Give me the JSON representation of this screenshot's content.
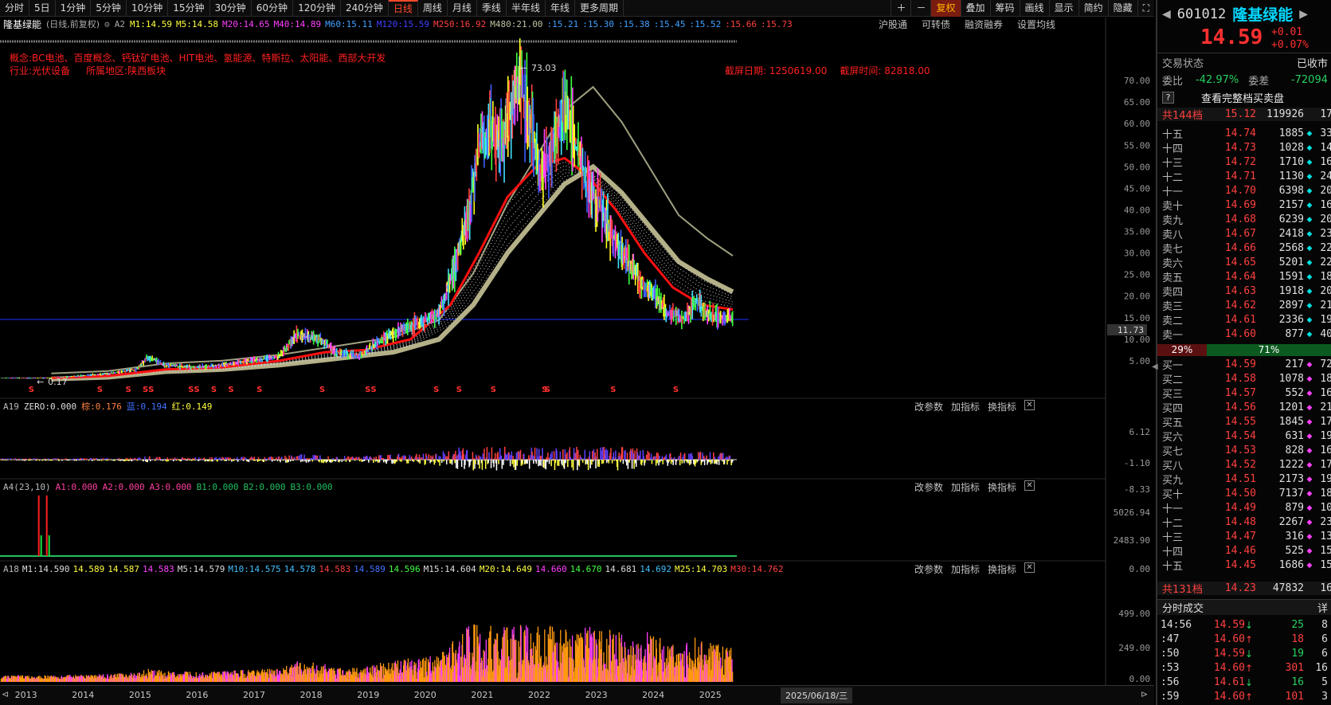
{
  "toolbar": {
    "periods": [
      "分时",
      "5日",
      "1分钟",
      "5分钟",
      "10分钟",
      "15分钟",
      "30分钟",
      "60分钟",
      "120分钟",
      "240分钟",
      "日线",
      "周线",
      "月线",
      "季线",
      "半年线",
      "年线",
      "更多周期"
    ],
    "right": [
      "复权",
      "叠加",
      "筹码",
      "画线",
      "显示",
      "简约",
      "隐藏"
    ]
  },
  "header": {
    "name": "隆基绿能",
    "period": "(日线,前复权)",
    "a2": "A2",
    "ma": [
      {
        "t": "M1:14.59",
        "c": "#ffff40"
      },
      {
        "t": "M5:14.58",
        "c": "#ffff40"
      },
      {
        "t": "M20:14.65",
        "c": "#ff40ff"
      },
      {
        "t": "M40:14.89",
        "c": "#ff40ff"
      },
      {
        "t": "M60:15.11",
        "c": "#40a0ff"
      },
      {
        "t": "M120:15.59",
        "c": "#4040ff"
      },
      {
        "t": "M250:16.92",
        "c": "#ff4040"
      },
      {
        "t": "M480:21.00",
        "c": "#c0c0a0"
      },
      {
        "t": ":15.21",
        "c": "#40a0ff"
      },
      {
        "t": ":15.30",
        "c": "#40a0ff"
      },
      {
        "t": ":15.38",
        "c": "#40a0ff"
      },
      {
        "t": ":15.45",
        "c": "#40a0ff"
      },
      {
        "t": ":15.52",
        "c": "#40a0ff"
      },
      {
        "t": ":15.66",
        "c": "#ff4040"
      },
      {
        "t": ":15.73",
        "c": "#ff4040"
      }
    ],
    "links": [
      "沪股通",
      "可转债",
      "融资融券",
      "设置均线"
    ]
  },
  "info": {
    "concepts": "概念:BC电池、百度概念、钙钛矿电池、HIT电池、氢能源、特斯拉、太阳能、西部大开发",
    "industry": "行业:光伏设备",
    "region": "所属地区:陕西板块",
    "shot_date": "截屏日期: 1250619.00",
    "shot_time": "截屏时间: 82818.00"
  },
  "chart_data": {
    "type": "line",
    "title": "隆基绿能",
    "x_years": [
      "2013",
      "2014",
      "2015",
      "2016",
      "2017",
      "2018",
      "2019",
      "2020",
      "2021",
      "2022",
      "2023",
      "2024",
      "2025"
    ],
    "y_ticks": [
      "70.00",
      "65.00",
      "60.00",
      "55.00",
      "50.00",
      "45.00",
      "40.00",
      "35.00",
      "30.00",
      "25.00",
      "20.00",
      "15.00",
      "10.00",
      "5.00"
    ],
    "ylim": [
      0,
      75
    ],
    "high_label": "73.03",
    "low_label": "0.17",
    "current_price_tag": "11.73",
    "close_points": [
      [
        2013.0,
        1.0
      ],
      [
        2013.5,
        1.0
      ],
      [
        2014.0,
        1.5
      ],
      [
        2014.5,
        2.0
      ],
      [
        2015.0,
        3.0
      ],
      [
        2015.2,
        6.0
      ],
      [
        2015.5,
        4.0
      ],
      [
        2016.0,
        3.5
      ],
      [
        2016.5,
        4.0
      ],
      [
        2017.0,
        5.0
      ],
      [
        2017.5,
        6.0
      ],
      [
        2017.8,
        11.0
      ],
      [
        2018.2,
        10.0
      ],
      [
        2018.5,
        7.0
      ],
      [
        2018.9,
        6.0
      ],
      [
        2019.3,
        10.0
      ],
      [
        2019.6,
        12.0
      ],
      [
        2020.0,
        14.0
      ],
      [
        2020.3,
        16.0
      ],
      [
        2020.6,
        28.0
      ],
      [
        2020.8,
        38.0
      ],
      [
        2021.0,
        55.0
      ],
      [
        2021.2,
        58.0
      ],
      [
        2021.4,
        55.0
      ],
      [
        2021.7,
        70.0
      ],
      [
        2021.9,
        60.0
      ],
      [
        2022.1,
        48.0
      ],
      [
        2022.3,
        55.0
      ],
      [
        2022.5,
        65.0
      ],
      [
        2022.7,
        55.0
      ],
      [
        2022.9,
        45.0
      ],
      [
        2023.1,
        42.0
      ],
      [
        2023.3,
        35.0
      ],
      [
        2023.6,
        28.0
      ],
      [
        2023.9,
        22.0
      ],
      [
        2024.1,
        20.0
      ],
      [
        2024.3,
        16.0
      ],
      [
        2024.6,
        15.0
      ],
      [
        2024.8,
        19.0
      ],
      [
        2025.0,
        16.0
      ],
      [
        2025.3,
        15.0
      ],
      [
        2025.45,
        14.6
      ]
    ],
    "ma250_points": [
      [
        2013.5,
        1.0
      ],
      [
        2014.5,
        1.5
      ],
      [
        2015.5,
        3.0
      ],
      [
        2016.5,
        3.5
      ],
      [
        2017.5,
        5.0
      ],
      [
        2018.3,
        7.0
      ],
      [
        2019.0,
        7.5
      ],
      [
        2019.8,
        10.0
      ],
      [
        2020.5,
        18.0
      ],
      [
        2021.0,
        30.0
      ],
      [
        2021.5,
        43.0
      ],
      [
        2022.0,
        50.0
      ],
      [
        2022.5,
        52.0
      ],
      [
        2022.9,
        48.0
      ],
      [
        2023.4,
        40.0
      ],
      [
        2023.9,
        30.0
      ],
      [
        2024.4,
        22.0
      ],
      [
        2024.9,
        18.0
      ],
      [
        2025.45,
        16.9
      ]
    ],
    "ma480_points": [
      [
        2013.5,
        0.8
      ],
      [
        2014.5,
        1.2
      ],
      [
        2015.5,
        2.5
      ],
      [
        2016.5,
        3.0
      ],
      [
        2017.5,
        4.0
      ],
      [
        2018.5,
        5.5
      ],
      [
        2019.5,
        7.0
      ],
      [
        2020.3,
        10.0
      ],
      [
        2020.9,
        18.0
      ],
      [
        2021.5,
        30.0
      ],
      [
        2022.0,
        38.0
      ],
      [
        2022.5,
        46.0
      ],
      [
        2023.0,
        50.0
      ],
      [
        2023.5,
        44.0
      ],
      [
        2024.0,
        36.0
      ],
      [
        2024.5,
        28.0
      ],
      [
        2025.0,
        24.0
      ],
      [
        2025.45,
        21.0
      ]
    ],
    "markers_s": [
      2013.1,
      2014.3,
      2014.8,
      2015.1,
      2015.2,
      2015.9,
      2016.0,
      2016.3,
      2016.6,
      2017.1,
      2018.2,
      2019.0,
      2019.1,
      2020.2,
      2020.6,
      2021.2,
      2022.1,
      2022.15,
      2023.3,
      2024.4
    ]
  },
  "sub1": {
    "label": "A19",
    "params": [
      "ZERO:0.000",
      "棕:0.176",
      "蓝:0.194",
      "红:0.149"
    ],
    "ticks": [
      "6.12",
      "-1.10",
      "-8.33"
    ]
  },
  "sub2": {
    "label": "A4(23,10)",
    "params": [
      "A1:0.000",
      "A2:0.000",
      "A3:0.000",
      "B1:0.000",
      "B2:0.000",
      "B3:0.000"
    ],
    "ticks": [
      "5026.94",
      "2483.90",
      "0.00"
    ]
  },
  "sub3": {
    "label": "A18",
    "params": [
      "M1:14.590",
      "14.589",
      "14.587",
      "14.583",
      "M5:14.579",
      "M10:14.575",
      "14.578",
      "14.583",
      "14.589",
      "14.596",
      "M15:14.604",
      "M20:14.649",
      "14.660",
      "14.670",
      "14.681",
      "14.692",
      "M25:14.703",
      "M30:14.762"
    ],
    "ticks": [
      "499.00",
      "249.00",
      "0.00"
    ]
  },
  "pane_tools": [
    "改参数",
    "加指标",
    "换指标"
  ],
  "bottom_date": "2025/06/18/三",
  "right_panel": {
    "code": "601012",
    "name": "隆基绿能",
    "price": "14.59",
    "chg": "+0.01",
    "pct": "+0.07%",
    "status_label": "交易状态",
    "status": "已收市",
    "webi_label": "委比",
    "webi": "-42.97%",
    "weicha_label": "委差",
    "weicha": "-72094",
    "full_book": "查看完整档买卖盘",
    "sell_total": {
      "label": "共144档",
      "price": "15.12",
      "vol": "119926",
      "n": "17"
    },
    "asks": [
      [
        "十五",
        "14.74",
        "1885",
        "33"
      ],
      [
        "十四",
        "14.73",
        "1028",
        "14"
      ],
      [
        "十三",
        "14.72",
        "1710",
        "16"
      ],
      [
        "十二",
        "14.71",
        "1130",
        "24"
      ],
      [
        "十一",
        "14.70",
        "6398",
        "20"
      ],
      [
        "卖十",
        "14.69",
        "2157",
        "16"
      ],
      [
        "卖九",
        "14.68",
        "6239",
        "20"
      ],
      [
        "卖八",
        "14.67",
        "2418",
        "23"
      ],
      [
        "卖七",
        "14.66",
        "2568",
        "22"
      ],
      [
        "卖六",
        "14.65",
        "5201",
        "22"
      ],
      [
        "卖五",
        "14.64",
        "1591",
        "18"
      ],
      [
        "卖四",
        "14.63",
        "1918",
        "20"
      ],
      [
        "卖三",
        "14.62",
        "2897",
        "21"
      ],
      [
        "卖二",
        "14.61",
        "2336",
        "19"
      ],
      [
        "卖一",
        "14.60",
        "877",
        "40"
      ]
    ],
    "ratio_sell": "29%",
    "ratio_buy": "71%",
    "bids": [
      [
        "买一",
        "14.59",
        "217",
        "72"
      ],
      [
        "买二",
        "14.58",
        "1078",
        "18"
      ],
      [
        "买三",
        "14.57",
        "552",
        "16"
      ],
      [
        "买四",
        "14.56",
        "1201",
        "21"
      ],
      [
        "买五",
        "14.55",
        "1845",
        "17"
      ],
      [
        "买六",
        "14.54",
        "631",
        "19"
      ],
      [
        "买七",
        "14.53",
        "828",
        "16"
      ],
      [
        "买八",
        "14.52",
        "1222",
        "17"
      ],
      [
        "买九",
        "14.51",
        "2173",
        "19"
      ],
      [
        "买十",
        "14.50",
        "7137",
        "18"
      ],
      [
        "十一",
        "14.49",
        "879",
        "10"
      ],
      [
        "十二",
        "14.48",
        "2267",
        "23"
      ],
      [
        "十三",
        "14.47",
        "316",
        "13"
      ],
      [
        "十四",
        "14.46",
        "525",
        "15"
      ],
      [
        "十五",
        "14.45",
        "1686",
        "15"
      ]
    ],
    "buy_total": {
      "label": "共131档",
      "price": "14.23",
      "vol": "47832",
      "n": "16"
    },
    "ticks_title": "分时成交",
    "ticks_more": "详",
    "trades": [
      [
        "14:56",
        "14.59",
        "25",
        "8"
      ],
      [
        ":47",
        "14.60",
        "18",
        "6"
      ],
      [
        ":50",
        "14.59",
        "19",
        "6"
      ],
      [
        ":53",
        "14.60",
        "301",
        "16"
      ],
      [
        ":56",
        "14.61",
        "16",
        "5"
      ],
      [
        ":59",
        "14.60",
        "101",
        "3"
      ]
    ]
  }
}
